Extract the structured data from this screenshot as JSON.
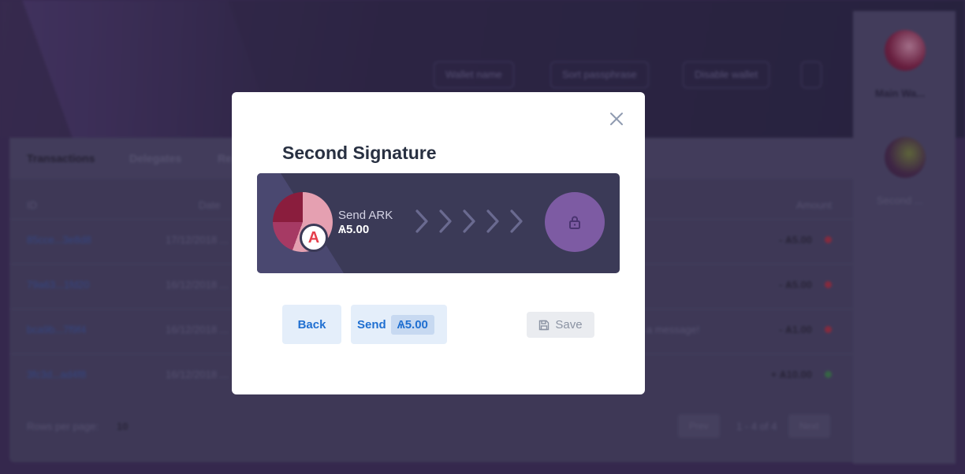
{
  "background": {
    "actions": [
      {
        "label": "Wallet name",
        "icon": "edit-icon"
      },
      {
        "label": "Sort passphrase",
        "icon": "key-icon"
      },
      {
        "label": "Disable wallet",
        "icon": "edit-icon"
      }
    ],
    "tabs": [
      "Transactions",
      "Delegates",
      "Re..."
    ],
    "headers": {
      "id": "ID",
      "date": "Date",
      "amount": "Amount"
    },
    "rows": [
      {
        "id": "85cce...3e8d8",
        "date": "17/12/2018 ...",
        "memo": "",
        "amount": "- Ѧ5.00",
        "status": "out"
      },
      {
        "id": "79a63...1fd20",
        "date": "16/12/2018 ...",
        "memo": "",
        "amount": "- Ѧ5.00",
        "status": "out"
      },
      {
        "id": "bca9b...7f9f4",
        "date": "16/12/2018 ...",
        "memo": "a message!",
        "amount": "- Ѧ1.00",
        "status": "out"
      },
      {
        "id": "3fc3d...ad4f8",
        "date": "16/12/2018 ...",
        "memo": "",
        "amount": "+ Ѧ10.00",
        "status": "in"
      }
    ],
    "rows_per_page_label": "Rows per page:",
    "rows_per_page_value": "10",
    "pager": {
      "prev": "Prev",
      "range": "1 - 4 of 4",
      "next": "Next"
    },
    "wallets": [
      "Main Wa...",
      "Second ..."
    ]
  },
  "modal": {
    "title": "Second Signature",
    "close_icon": "close-icon",
    "transaction": {
      "label": "Send ARK",
      "amount": "Ѧ5.00",
      "symbol": "A",
      "lock_icon": "lock-icon",
      "chevron_count": 5
    },
    "buttons": {
      "back": "Back",
      "send": "Send",
      "send_amount": "Ѧ5.00",
      "save": "Save"
    }
  },
  "colors": {
    "accent_blue": "#1f6fd1",
    "lock_purple": "#7d5ba3",
    "card_bg": "#3b3a57",
    "ark_red": "#e53e4b"
  }
}
